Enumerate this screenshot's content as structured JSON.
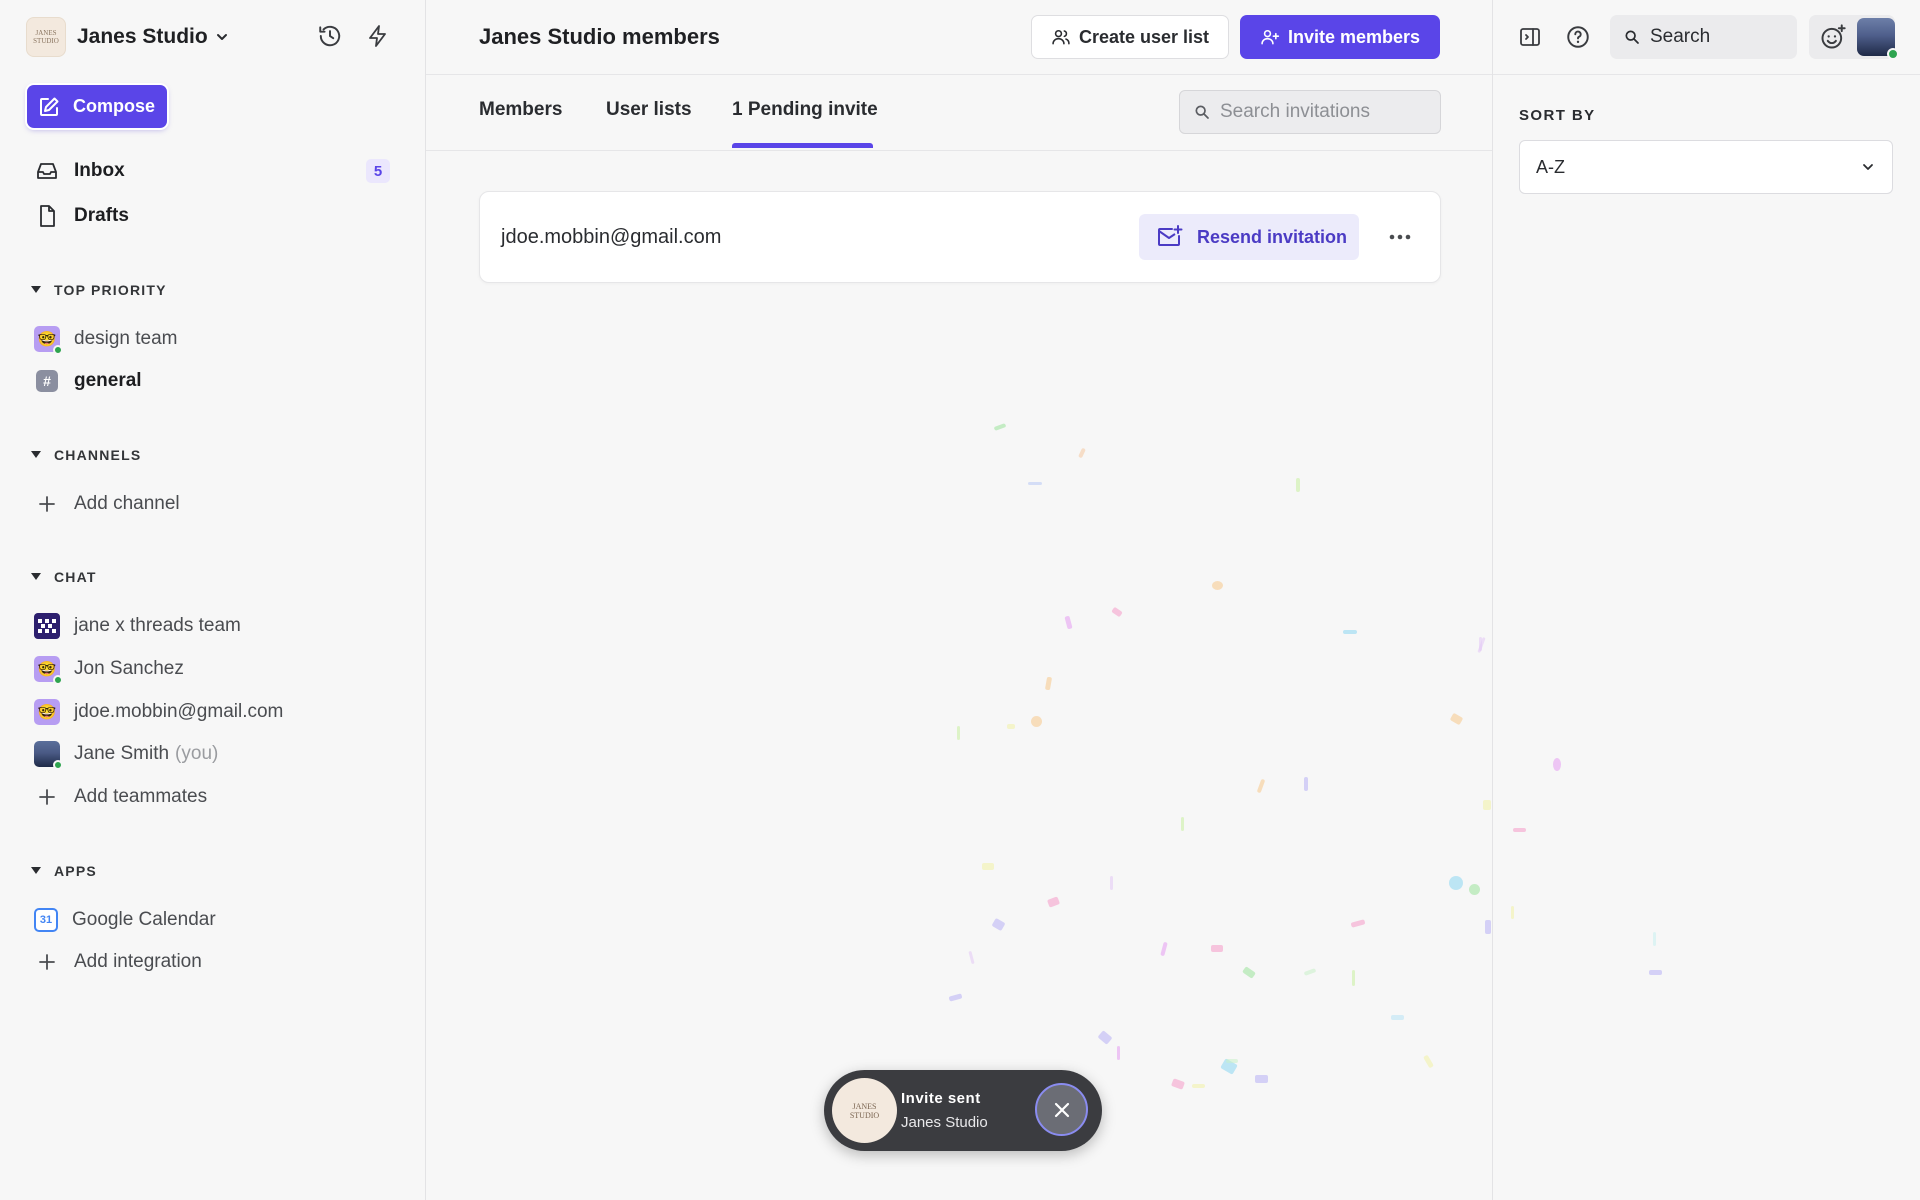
{
  "workspace": {
    "name": "Janes Studio",
    "logo_text": "JANES STUDIO"
  },
  "sidebar": {
    "compose_label": "Compose",
    "nav": [
      {
        "label": "Inbox",
        "badge": "5"
      },
      {
        "label": "Drafts"
      }
    ],
    "sections": {
      "top_priority": "TOP PRIORITY",
      "channels": "CHANNELS",
      "chat": "CHAT",
      "apps": "APPS"
    },
    "top_priority_items": [
      {
        "label": "design team"
      },
      {
        "label": "general"
      }
    ],
    "add_channel": "Add channel",
    "chat_items": [
      {
        "label": "jane x threads team"
      },
      {
        "label": "Jon Sanchez"
      },
      {
        "label": "jdoe.mobbin@gmail.com"
      },
      {
        "label": "Jane Smith",
        "suffix": "(you)"
      }
    ],
    "add_teammates": "Add teammates",
    "app_items": [
      {
        "label": "Google Calendar",
        "icon_text": "31"
      }
    ],
    "add_integration": "Add integration"
  },
  "header": {
    "title": "Janes Studio members",
    "create_user_list": "Create user list",
    "invite_members": "Invite members"
  },
  "tabs": [
    {
      "label": "Members"
    },
    {
      "label": "User lists"
    },
    {
      "label": "1 Pending invite",
      "active": true
    }
  ],
  "search_invitations": {
    "placeholder": "Search invitations"
  },
  "invitations": [
    {
      "email": "jdoe.mobbin@gmail.com",
      "action": "Resend invitation"
    }
  ],
  "right_panel": {
    "search_label": "Search",
    "sort_by_label": "SORT BY",
    "sort_value": "A-Z"
  },
  "toast": {
    "title": "Invite sent",
    "subtitle": "Janes Studio",
    "logo_text": "JANES STUDIO"
  },
  "colors": {
    "accent": "#5a45e8",
    "online": "#2ea44f",
    "toast_bg": "#3b3c40"
  },
  "icons": [
    "chevron-down-icon",
    "history-icon",
    "lightning-icon",
    "compose-icon",
    "inbox-icon",
    "document-icon",
    "triangle-down-icon",
    "plus-icon",
    "users-icon",
    "user-plus-icon",
    "search-icon",
    "mail-plus-icon",
    "more-horizontal-icon",
    "sidebar-toggle-icon",
    "help-icon",
    "emoji-add-icon",
    "close-icon"
  ]
}
